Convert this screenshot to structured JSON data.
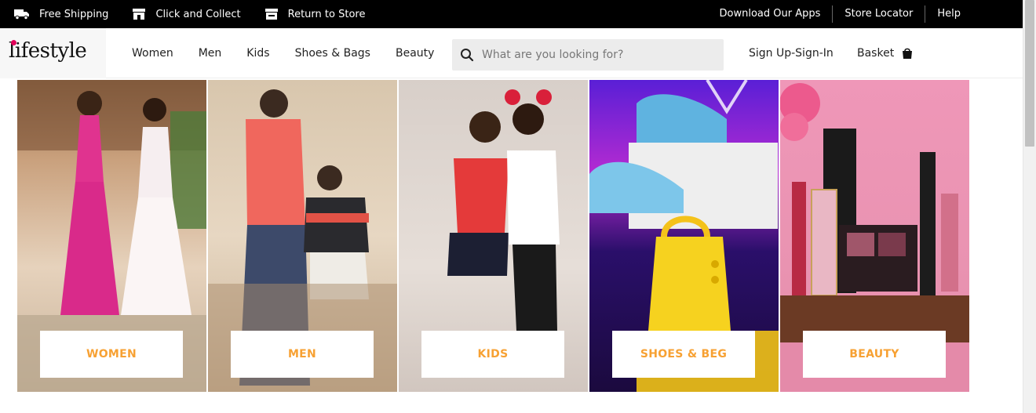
{
  "topbar": {
    "free_shipping": "Free Shipping",
    "click_collect": "Click and Collect",
    "return_store": "Return to Store",
    "download_apps": "Download Our Apps",
    "store_locator": "Store Locator",
    "help": "Help"
  },
  "header": {
    "logo": "lifestyle",
    "nav": [
      "Women",
      "Men",
      "Kids",
      "Shoes & Bags",
      "Beauty"
    ],
    "search_placeholder": "What are you looking for?",
    "signin": "Sign Up-Sign-In",
    "basket": "Basket"
  },
  "tiles": [
    {
      "label": "WOMEN"
    },
    {
      "label": "MEN"
    },
    {
      "label": "KIDS"
    },
    {
      "label": "SHOES & BEG"
    },
    {
      "label": "BEAUTY"
    }
  ],
  "colors": {
    "cta_text": "#f7a133",
    "topbar_bg": "#000000",
    "logo_dot": "#e2005a"
  },
  "icons": [
    "truck-icon",
    "store-icon",
    "return-store-icon",
    "search-icon",
    "basket-icon"
  ]
}
